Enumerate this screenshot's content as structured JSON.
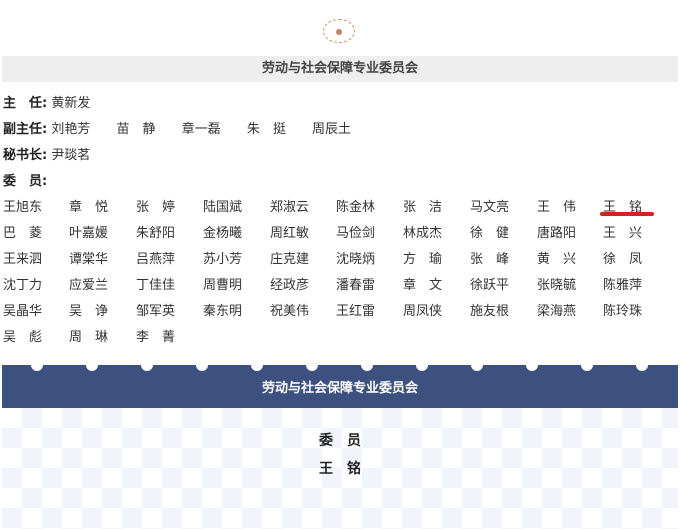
{
  "committee": {
    "title": "劳动与社会保障专业委员会",
    "chair_label": "主　任:",
    "chair": "黄新发",
    "vice_label": "副主任:",
    "vice_chairs": [
      "刘艳芳",
      "苗　静",
      "章一磊",
      "朱　挺",
      "周辰土"
    ],
    "secretary_label": "秘书长:",
    "secretary": "尹琰茗",
    "members_label": "委　员:",
    "members": [
      [
        "王旭东",
        "章　悦",
        "张　婷",
        "陆国斌",
        "郑淑云",
        "陈金林",
        "张　洁",
        "马文亮",
        "王　伟",
        "王　铭"
      ],
      [
        "巴　菱",
        "叶嘉媛",
        "朱舒阳",
        "金杨曦",
        "周红敏",
        "马俭剑",
        "林成杰",
        "徐　健",
        "唐路阳",
        "王　兴"
      ],
      [
        "王来泗",
        "谭棠华",
        "吕燕萍",
        "苏小芳",
        "庄克建",
        "沈晓炳",
        "方　瑜",
        "张　峰",
        "黄　兴",
        "徐　凤"
      ],
      [
        "沈丁力",
        "应爱兰",
        "丁佳佳",
        "周曹明",
        "经政彦",
        "潘春雷",
        "章　文",
        "徐跃平",
        "张晓毓",
        "陈雅萍"
      ],
      [
        "吴晶华",
        "吴　诤",
        "邹军英",
        "秦东明",
        "祝美伟",
        "王红雷",
        "周凤侠",
        "施友根",
        "梁海燕",
        "陈玲珠"
      ],
      [
        "吴　彪",
        "周　琳",
        "李　菁"
      ]
    ]
  },
  "card": {
    "title": "劳动与社会保障专业委员会",
    "role": "委　员",
    "name": "王　铭"
  },
  "colors": {
    "header_band": "#3c5180",
    "highlight": "#d42222",
    "ornament": "#c8956a"
  }
}
